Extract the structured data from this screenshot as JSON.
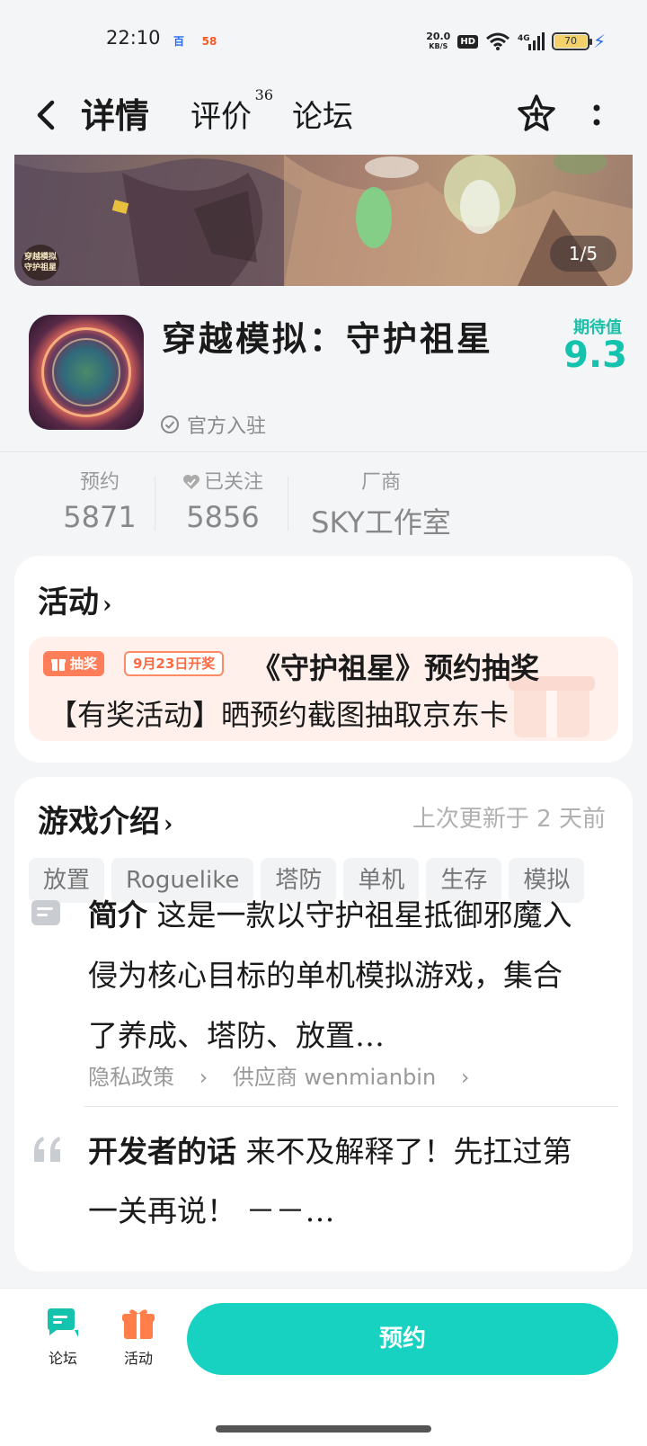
{
  "status_bar": {
    "time": "22:10",
    "app_icon_1": "百",
    "app_icon_2": "58",
    "net_speed_value": "20.0",
    "net_speed_unit": "KB/S",
    "hd_label": "HD",
    "network_label": "4G",
    "battery": "70"
  },
  "header": {
    "tabs": [
      {
        "label": "详情",
        "active": true
      },
      {
        "label": "评价",
        "count": "36"
      },
      {
        "label": "论坛"
      }
    ],
    "accent_color": "#1ad1bd"
  },
  "banner": {
    "logo_text_line1": "穿越模拟",
    "logo_text_line2": "守护祖星",
    "page_indicator": "1/5"
  },
  "game": {
    "title": "穿越模拟：守护祖星",
    "official_label": "官方入驻",
    "expect_label": "期待值",
    "expect_value": "9.3"
  },
  "stats": {
    "reservations_label": "预约",
    "reservations_value": "5871",
    "followed_label": "已关注",
    "followed_value": "5856",
    "vendor_label": "厂商",
    "vendor_value": "SKY工作室"
  },
  "activity": {
    "title": "活动",
    "badge_lottery": "抽奖",
    "badge_date": "9月23日开奖",
    "line1": "《守护祖星》预约抽奖",
    "line2": "【有奖活动】晒预约截图抽取京东卡"
  },
  "intro": {
    "title": "游戏介绍",
    "updated": "上次更新于 2 天前",
    "tags": [
      "放置",
      "Roguelike",
      "塔防",
      "单机",
      "生存",
      "模拟"
    ],
    "summary_label": "简介",
    "summary_text": " 这是一款以守护祖星抵御邪魔入侵为核心目标的单机模拟游戏，集合了养成、塔防、放置…",
    "privacy_link": "隐私政策",
    "supplier_link": "供应商 wenmianbin",
    "dev_label": "开发者的话",
    "dev_text": " 来不及解释了！先扛过第一关再说！ －－…"
  },
  "bottom_bar": {
    "forum_label": "论坛",
    "activity_label": "活动",
    "reserve_label": "预约",
    "reserve_color": "#17d2c0"
  }
}
